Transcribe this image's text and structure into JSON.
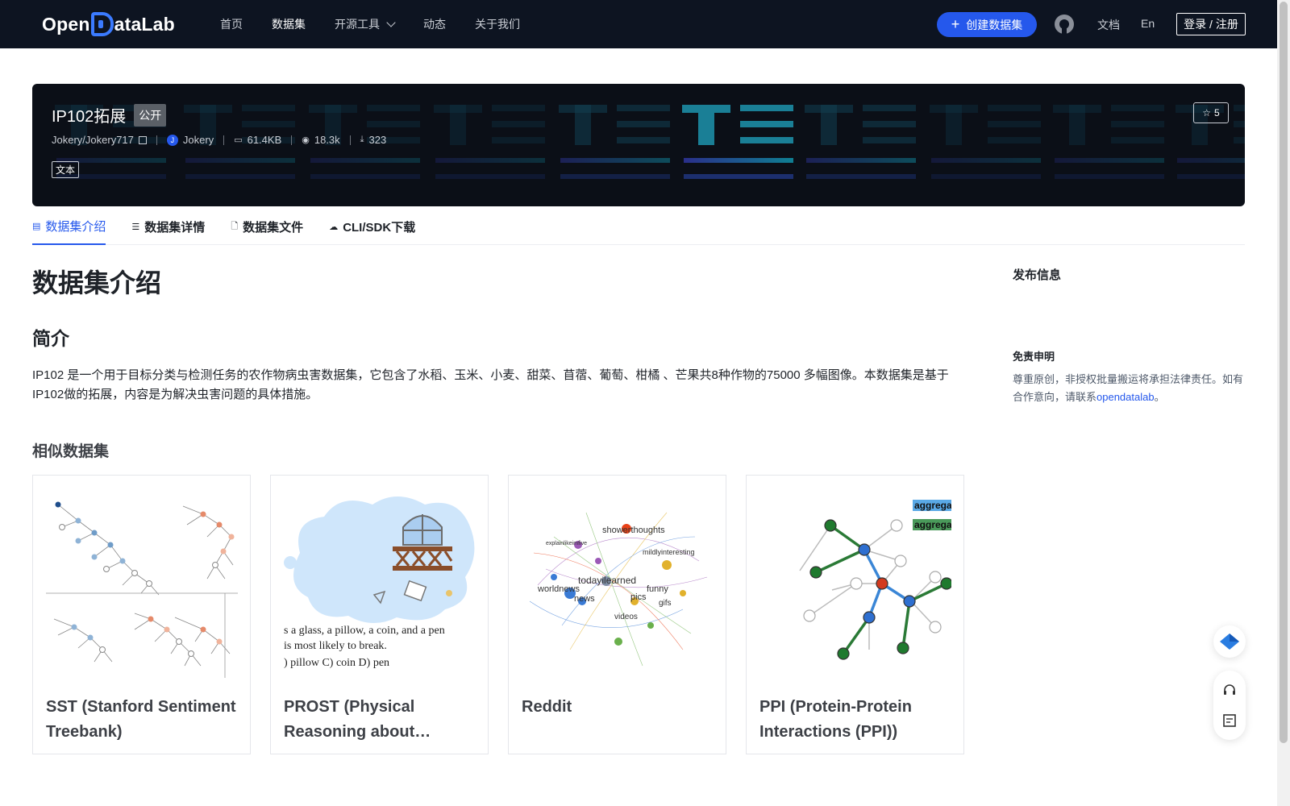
{
  "nav": {
    "logo": "OpenDataLab",
    "links": [
      "首页",
      "数据集",
      "开源工具",
      "动态",
      "关于我们"
    ],
    "create_button": "创建数据集",
    "docs": "文档",
    "lang": "En",
    "login": "登录 / 注册"
  },
  "dataset": {
    "title": "IP102拓展",
    "visibility": "公开",
    "repo": "Jokery/Jokery717",
    "author": "Jokery",
    "author_initial": "J",
    "size": "61.4KB",
    "views": "18.3k",
    "downloads": "323",
    "tag": "文本",
    "stars": "5"
  },
  "tabs": [
    "数据集介绍",
    "数据集详情",
    "数据集文件",
    "CLI/SDK下载"
  ],
  "main": {
    "heading": "数据集介绍",
    "intro_heading": "简介",
    "intro_text": "IP102 是一个用于目标分类与检测任务的农作物病虫害数据集，它包含了水稻、玉米、小麦、甜菜、苜蓿、葡萄、柑橘 、芒果共8种作物的75000 多幅图像。本数据集是基于IP102做的拓展，内容是为解决虫害问题的具体措施。",
    "similar_heading": "相似数据集",
    "similar": [
      {
        "title": "SST (Stanford Sentiment Treebank)"
      },
      {
        "title": "PROST (Physical Reasoning about…"
      },
      {
        "title": "Reddit"
      },
      {
        "title": "PPI (Protein-Protein Interactions (PPI))"
      }
    ]
  },
  "sidebar": {
    "publish_heading": "发布信息",
    "disclaimer_heading": "免责申明",
    "disclaimer_text": "尊重原创，非授权批量搬运将承担法律责任。如有合作意向，请联系",
    "disclaimer_link": "opendatalab",
    "disclaimer_end": "。"
  },
  "thumb_text": {
    "prost_line1": "s a glass, a pillow, a coin, and a pen",
    "prost_line2": "is most likely to break.",
    "prost_line3": ") pillow   C) coin      D) pen",
    "reddit_words": [
      "showerthoughts",
      "explainlikeimfive",
      "mildlyinteresting",
      "todayilearned",
      "worldnews",
      "news",
      "funny",
      "pics",
      "gifs",
      "videos"
    ],
    "ppi_label": "aggregat"
  },
  "colors": {
    "nav_bg": "#0d1421",
    "accent": "#2558ec",
    "banner_bg": "#0b0f17"
  }
}
